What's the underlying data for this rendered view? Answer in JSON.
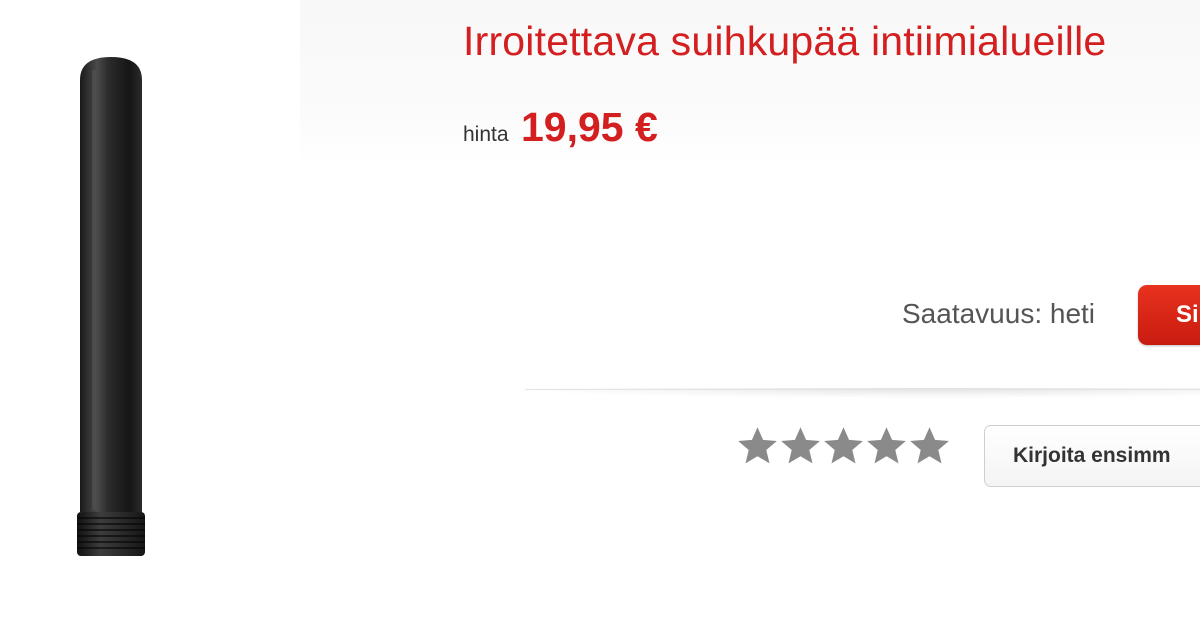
{
  "product": {
    "title": "Irroitettava suihkupää intiimialueille",
    "price_label": "hinta",
    "price": "19,95 €",
    "image_alt": "product-image"
  },
  "availability": {
    "text": "Saatavuus: heti"
  },
  "buy_button": {
    "label": "Si"
  },
  "rating": {
    "stars_filled": 0,
    "stars_total": 5,
    "star_color": "#8a8a8a"
  },
  "review_button": {
    "label": "Kirjoita ensimm"
  },
  "colors": {
    "accent": "#d31f1f",
    "button": "#d9281a"
  }
}
